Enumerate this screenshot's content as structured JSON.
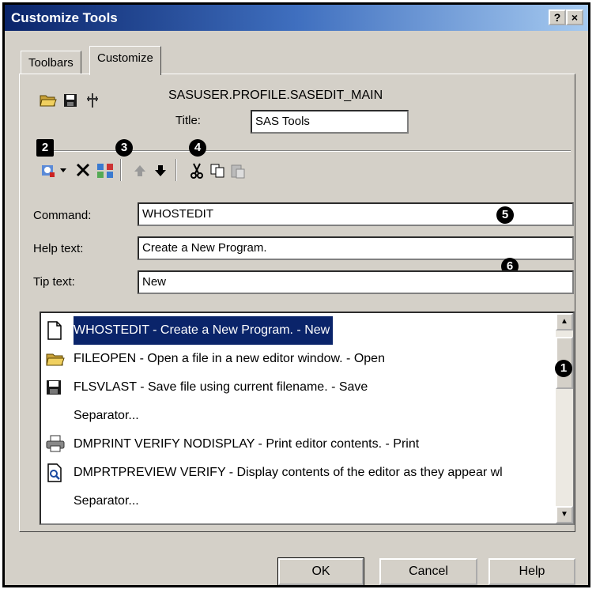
{
  "window": {
    "title": "Customize Tools",
    "help_button": "?",
    "close_button": "×"
  },
  "tabs": [
    {
      "label": "Toolbars"
    },
    {
      "label": "Customize"
    }
  ],
  "profile": {
    "path": "SASUSER.PROFILE.SASEDIT_MAIN",
    "title_label": "Title:",
    "title_value": "SAS Tools"
  },
  "callouts": [
    "1",
    "2",
    "3",
    "4",
    "5",
    "6"
  ],
  "fields": {
    "command_label": "Command:",
    "command_value": "WHOSTEDIT",
    "help_label": "Help text:",
    "help_value": "Create a New Program.",
    "tip_label": "Tip text:",
    "tip_value": "New"
  },
  "commands": [
    {
      "icon": "new-document-icon",
      "text": "WHOSTEDIT - Create a New Program. - New",
      "selected": true
    },
    {
      "icon": "open-folder-icon",
      "text": "FILEOPEN - Open a file in a new editor window. - Open"
    },
    {
      "icon": "save-disk-icon",
      "text": "FLSVLAST - Save file using current filename. - Save"
    },
    {
      "icon": "",
      "text": "Separator..."
    },
    {
      "icon": "printer-icon",
      "text": "DMPRINT VERIFY NODISPLAY - Print editor contents. - Print"
    },
    {
      "icon": "print-preview-icon",
      "text": "DMPRTPREVIEW VERIFY - Display contents of the editor as they appear wl"
    },
    {
      "icon": "",
      "text": "Separator..."
    }
  ],
  "buttons": {
    "ok": "OK",
    "cancel": "Cancel",
    "help": "Help"
  }
}
